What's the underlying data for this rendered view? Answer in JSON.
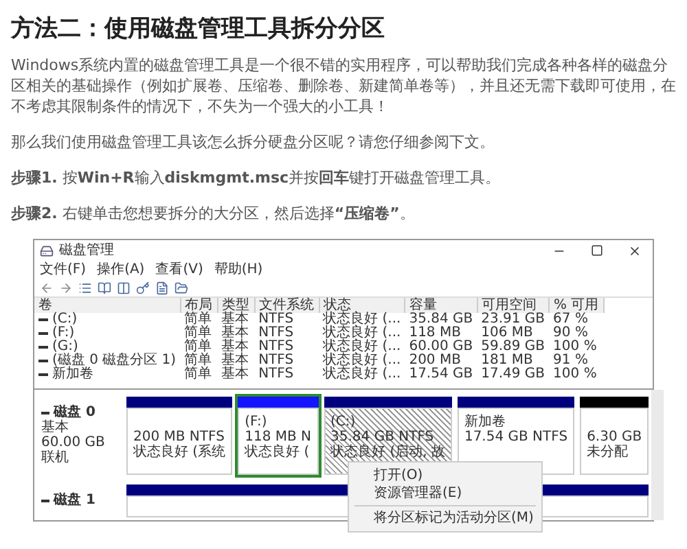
{
  "heading": "方法二：使用磁盘管理工具拆分分区",
  "paragraphs": [
    "Windows系统内置的磁盘管理工具是一个很不错的实用程序，可以帮助我们完成各种各样的磁盘分区相关的基础操作（例如扩展卷、压缩卷、删除卷、新建简单卷等），并且还无需下载即可使用，在不考虑其限制条件的情况下，不失为一个强大的小工具！",
    "那么我们使用磁盘管理工具该怎么拆分硬盘分区呢？请您仔细参阅下文。",
    "**步骤1.** 按**Win+R**输入**diskmgmt.msc**并按**回车**键打开磁盘管理工具。",
    "**步骤2.** 右键单击您想要拆分的大分区，然后选择**“压缩卷”**。"
  ],
  "window": {
    "title": "磁盘管理",
    "menu": [
      "文件(F)",
      "操作(A)",
      "查看(V)",
      "帮助(H)"
    ],
    "table": {
      "columns": [
        "卷",
        "布局",
        "类型",
        "文件系统",
        "状态",
        "容量",
        "可用空间",
        "% 可用"
      ],
      "rows": [
        [
          "(C:)",
          "简单",
          "基本",
          "NTFS",
          "状态良好 (...",
          "35.84 GB",
          "23.91 GB",
          "67 %"
        ],
        [
          "(F:)",
          "简单",
          "基本",
          "NTFS",
          "状态良好 (...",
          "118 MB",
          "106 MB",
          "90 %"
        ],
        [
          "(G:)",
          "简单",
          "基本",
          "NTFS",
          "状态良好 (...",
          "60.00 GB",
          "59.89 GB",
          "100 %"
        ],
        [
          "(磁盘 0 磁盘分区 1)",
          "简单",
          "基本",
          "NTFS",
          "状态良好 (...",
          "200 MB",
          "181 MB",
          "91 %"
        ],
        [
          "新加卷",
          "简单",
          "基本",
          "NTFS",
          "状态良好 (...",
          "17.54 GB",
          "17.49 GB",
          "100 %"
        ]
      ]
    },
    "disks": [
      {
        "name": "磁盘 0",
        "details": [
          "基本",
          "60.00 GB",
          "联机"
        ],
        "partitions": [
          {
            "kind": "primary",
            "selected": false,
            "focused": false,
            "size": "200 MB NTFS",
            "status": "状态良好 (系统"
          },
          {
            "kind": "primary",
            "selected": false,
            "focused": true,
            "label": "(F:)",
            "size": "118 MB N",
            "status": "状态良好 ("
          },
          {
            "kind": "primary",
            "selected": true,
            "focused": false,
            "label": "(C:)",
            "size": "35.84 GB NTFS",
            "status": "状态良好 (启动, 故"
          },
          {
            "kind": "primary",
            "selected": false,
            "focused": false,
            "label": "新加卷",
            "size": "17.54 GB NTFS"
          },
          {
            "kind": "unallocated",
            "selected": false,
            "focused": false,
            "size": "6.30 GB",
            "status": "未分配"
          }
        ]
      },
      {
        "name": "磁盘 1",
        "partitions": [
          {
            "kind": "primary",
            "selected": false,
            "focused": false
          }
        ]
      }
    ],
    "context_menu": [
      {
        "kind": "item",
        "label": "打开(O)"
      },
      {
        "kind": "item",
        "label": "资源管理器(E)"
      },
      {
        "kind": "separator"
      },
      {
        "kind": "item",
        "label": "将分区标记为活动分区(M)"
      }
    ]
  }
}
